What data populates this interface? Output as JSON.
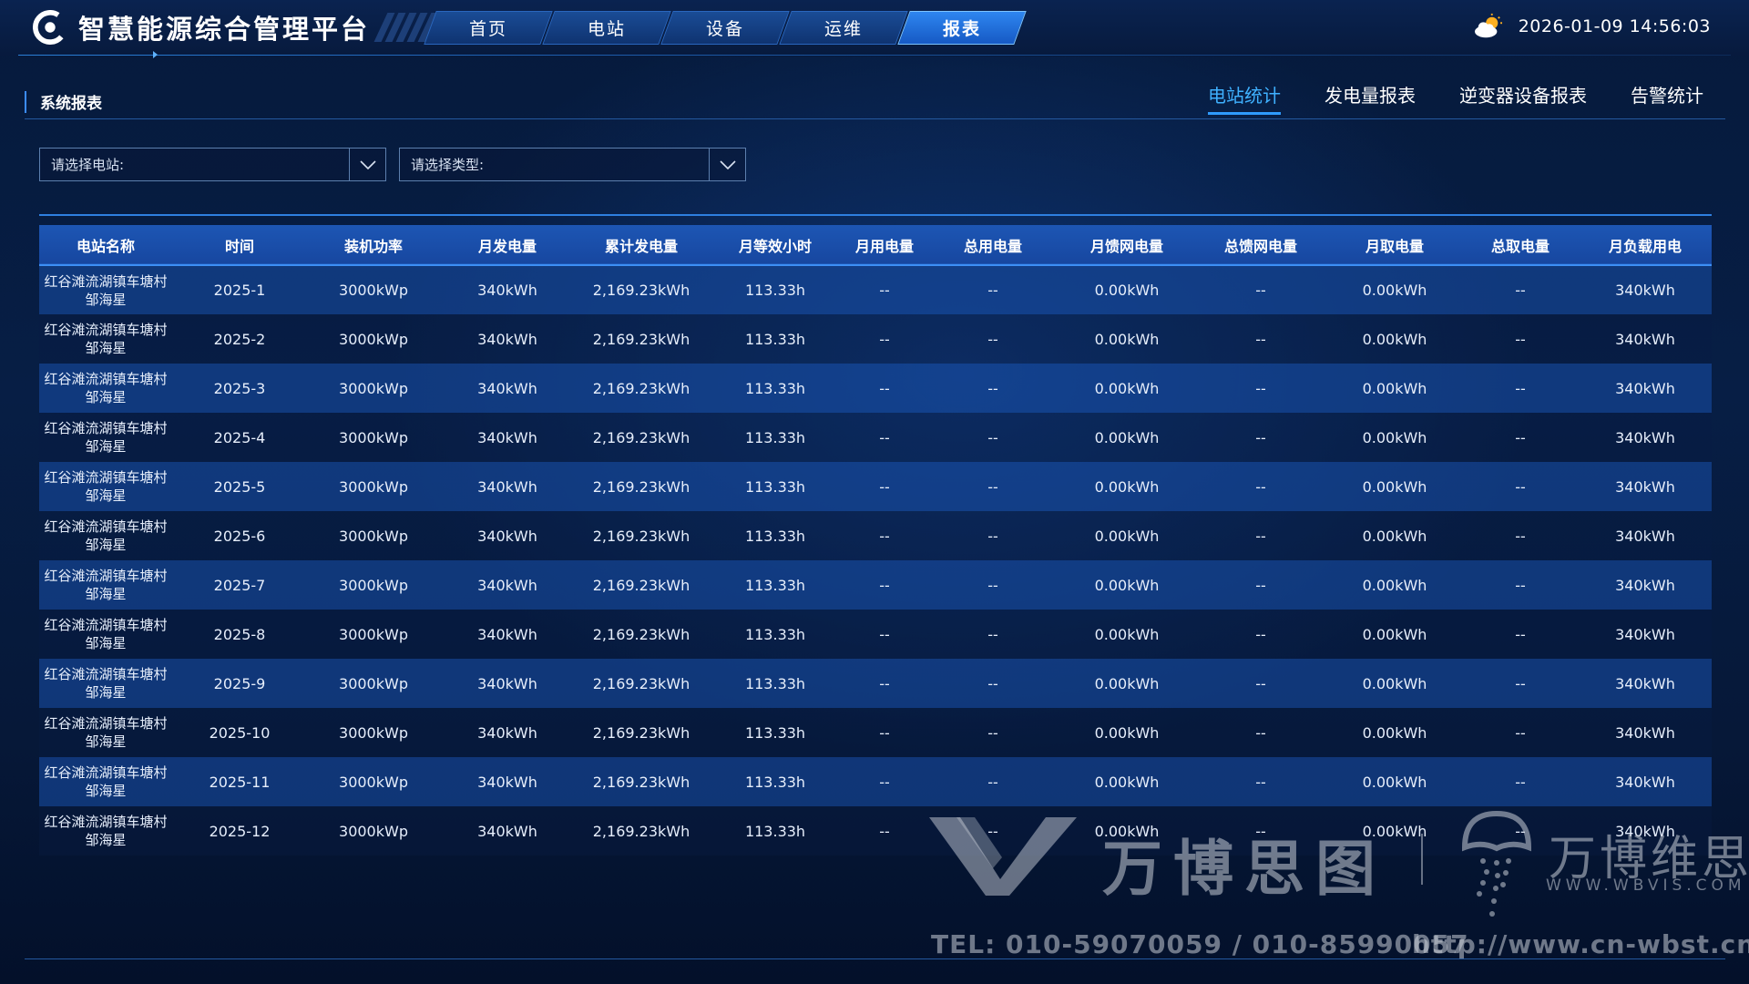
{
  "app": {
    "title": "智慧能源综合管理平台",
    "datetime": "2026-01-09 14:56:03"
  },
  "nav": {
    "tabs": [
      {
        "label": "首页",
        "active": false
      },
      {
        "label": "电站",
        "active": false
      },
      {
        "label": "设备",
        "active": false
      },
      {
        "label": "运维",
        "active": false
      },
      {
        "label": "报表",
        "active": true
      }
    ]
  },
  "section": {
    "title": "系统报表",
    "subtabs": [
      {
        "label": "电站统计",
        "active": true
      },
      {
        "label": "发电量报表",
        "active": false
      },
      {
        "label": "逆变器设备报表",
        "active": false
      },
      {
        "label": "告警统计",
        "active": false
      }
    ]
  },
  "filters": {
    "station_placeholder": "请选择电站:",
    "type_placeholder": "请选择类型:"
  },
  "table": {
    "columns": [
      "电站名称",
      "时间",
      "装机功率",
      "月发电量",
      "累计发电量",
      "月等效小时",
      "月用电量",
      "总用电量",
      "月馈网电量",
      "总馈网电量",
      "月取电量",
      "总取电量",
      "月负载用电"
    ],
    "rows": [
      [
        "红谷滩流湖镇车塘村邹海星",
        "2025-1",
        "3000kWp",
        "340kWh",
        "2,169.23kWh",
        "113.33h",
        "--",
        "--",
        "0.00kWh",
        "--",
        "0.00kWh",
        "--",
        "340kWh"
      ],
      [
        "红谷滩流湖镇车塘村邹海星",
        "2025-2",
        "3000kWp",
        "340kWh",
        "2,169.23kWh",
        "113.33h",
        "--",
        "--",
        "0.00kWh",
        "--",
        "0.00kWh",
        "--",
        "340kWh"
      ],
      [
        "红谷滩流湖镇车塘村邹海星",
        "2025-3",
        "3000kWp",
        "340kWh",
        "2,169.23kWh",
        "113.33h",
        "--",
        "--",
        "0.00kWh",
        "--",
        "0.00kWh",
        "--",
        "340kWh"
      ],
      [
        "红谷滩流湖镇车塘村邹海星",
        "2025-4",
        "3000kWp",
        "340kWh",
        "2,169.23kWh",
        "113.33h",
        "--",
        "--",
        "0.00kWh",
        "--",
        "0.00kWh",
        "--",
        "340kWh"
      ],
      [
        "红谷滩流湖镇车塘村邹海星",
        "2025-5",
        "3000kWp",
        "340kWh",
        "2,169.23kWh",
        "113.33h",
        "--",
        "--",
        "0.00kWh",
        "--",
        "0.00kWh",
        "--",
        "340kWh"
      ],
      [
        "红谷滩流湖镇车塘村邹海星",
        "2025-6",
        "3000kWp",
        "340kWh",
        "2,169.23kWh",
        "113.33h",
        "--",
        "--",
        "0.00kWh",
        "--",
        "0.00kWh",
        "--",
        "340kWh"
      ],
      [
        "红谷滩流湖镇车塘村邹海星",
        "2025-7",
        "3000kWp",
        "340kWh",
        "2,169.23kWh",
        "113.33h",
        "--",
        "--",
        "0.00kWh",
        "--",
        "0.00kWh",
        "--",
        "340kWh"
      ],
      [
        "红谷滩流湖镇车塘村邹海星",
        "2025-8",
        "3000kWp",
        "340kWh",
        "2,169.23kWh",
        "113.33h",
        "--",
        "--",
        "0.00kWh",
        "--",
        "0.00kWh",
        "--",
        "340kWh"
      ],
      [
        "红谷滩流湖镇车塘村邹海星",
        "2025-9",
        "3000kWp",
        "340kWh",
        "2,169.23kWh",
        "113.33h",
        "--",
        "--",
        "0.00kWh",
        "--",
        "0.00kWh",
        "--",
        "340kWh"
      ],
      [
        "红谷滩流湖镇车塘村邹海星",
        "2025-10",
        "3000kWp",
        "340kWh",
        "2,169.23kWh",
        "113.33h",
        "--",
        "--",
        "0.00kWh",
        "--",
        "0.00kWh",
        "--",
        "340kWh"
      ],
      [
        "红谷滩流湖镇车塘村邹海星",
        "2025-11",
        "3000kWp",
        "340kWh",
        "2,169.23kWh",
        "113.33h",
        "--",
        "--",
        "0.00kWh",
        "--",
        "0.00kWh",
        "--",
        "340kWh"
      ],
      [
        "红谷滩流湖镇车塘村邹海星",
        "2025-12",
        "3000kWp",
        "340kWh",
        "2,169.23kWh",
        "113.33h",
        "--",
        "--",
        "0.00kWh",
        "--",
        "0.00kWh",
        "--",
        "340kWh"
      ]
    ]
  },
  "watermark": {
    "brand_cn": "万博思图",
    "brand_cn2": "万博维思",
    "website": "WWW.WBVIS.COM",
    "tel": "TEL: 010-59070059 / 010-85990057",
    "url": "http://www.cn-wbst.cn"
  },
  "icons": {
    "logo": "logo-c-icon",
    "weather": "partly-cloudy-icon",
    "dropdown": "chevron-down-icon"
  },
  "colors": {
    "accent": "#2f9bff",
    "active_tab_text": "#3fb1ff",
    "header_bg": "#1d56b4"
  }
}
